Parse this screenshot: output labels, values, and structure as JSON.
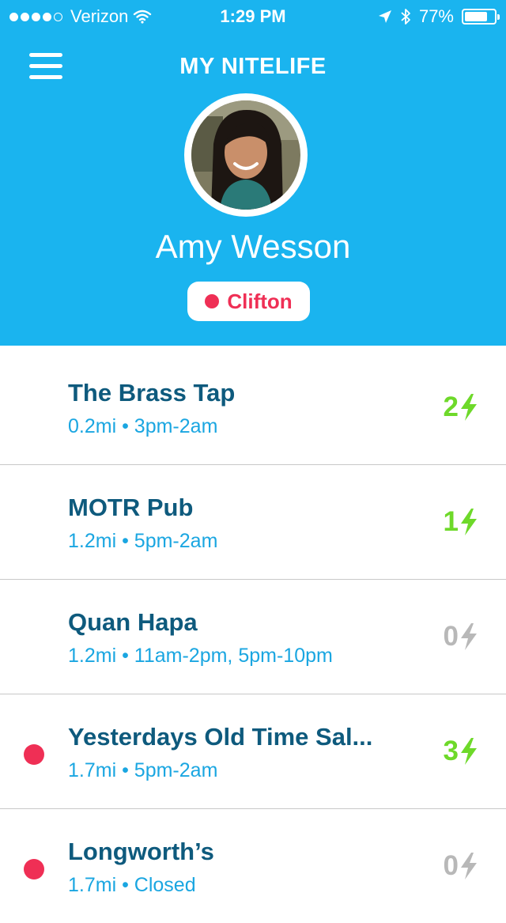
{
  "status_bar": {
    "carrier": "Verizon",
    "time": "1:29 PM",
    "battery_text": "77%",
    "battery_level": 0.77
  },
  "header": {
    "title": "MY NITELIFE",
    "user_name": "Amy Wesson",
    "location": "Clifton"
  },
  "venues": [
    {
      "name": "The Brass Tap",
      "distance": "0.2mi",
      "hours": "3pm-2am",
      "score": "2",
      "active": true,
      "marked": false
    },
    {
      "name": "MOTR Pub",
      "distance": "1.2mi",
      "hours": "5pm-2am",
      "score": "1",
      "active": true,
      "marked": false
    },
    {
      "name": "Quan Hapa",
      "distance": "1.2mi",
      "hours": "11am-2pm, 5pm-10pm",
      "score": "0",
      "active": false,
      "marked": false
    },
    {
      "name": "Yesterdays Old Time Sal...",
      "distance": "1.7mi",
      "hours": "5pm-2am",
      "score": "3",
      "active": true,
      "marked": true
    },
    {
      "name": "Longworth’s",
      "distance": "1.7mi",
      "hours": "Closed",
      "score": "0",
      "active": false,
      "marked": true
    }
  ],
  "colors": {
    "header_bg": "#1ab4ef",
    "venue_name": "#0e5a7d",
    "venue_info": "#1aa6e1",
    "score_active": "#6ed92a",
    "score_inactive": "#b8b8b8",
    "marker_red": "#ef2f55"
  },
  "icons": {
    "menu": "hamburger-icon",
    "wifi": "wifi-icon",
    "location_arrow": "location-arrow-icon",
    "bluetooth": "bluetooth-icon",
    "battery": "battery-icon",
    "score": "lightning-bolt-icon"
  }
}
